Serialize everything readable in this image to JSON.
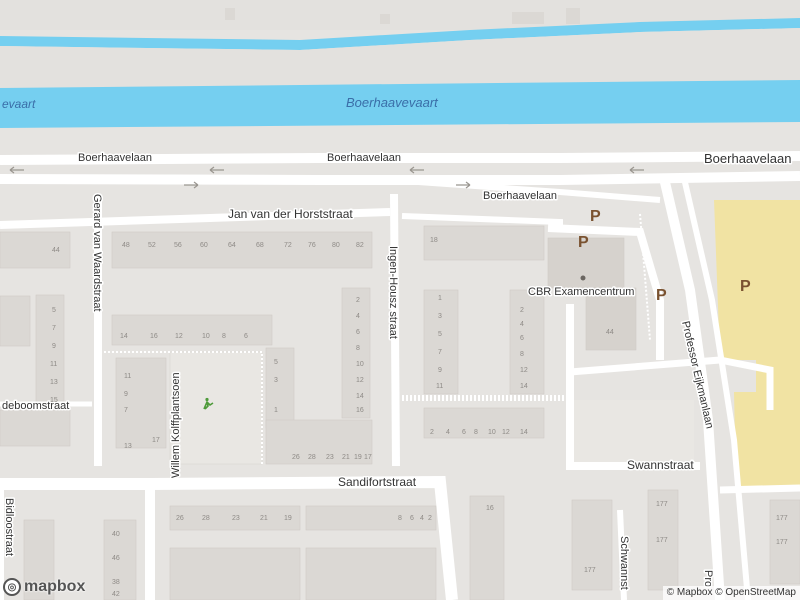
{
  "map": {
    "water": {
      "canal_name": "Boerhaavevaart",
      "canal_name_partial": "evaart"
    },
    "streets": {
      "boerhaavelaan": "Boerhaavelaan",
      "jan_van_der_horststraat": "Jan van der Horststraat",
      "gerard_van_waardstraat": "Gerard van Waardstraat",
      "ingen_housz_straat": "Ingen-Housz straat",
      "sandifortstraat": "Sandifortstraat",
      "swannstraat": "Swannstraat",
      "professor_eijkmanlaan": "Professor Eijkmanlaan",
      "willem_kolffplantsoen": "Willem Kolffplantsoen",
      "deboomstraat_partial": "deboomstraat",
      "bidloostraat_partial": "Bidloostraat",
      "schwannstraat_partial": "Schwannst",
      "prof_partial": "Pro"
    },
    "poi": {
      "cbr": "CBR Examencentrum"
    },
    "parking_symbol": "P",
    "playground_icon": "playground-icon",
    "house_numbers": {
      "row_a": [
        "48",
        "52",
        "56",
        "60",
        "64",
        "68",
        "72",
        "76",
        "80",
        "82"
      ],
      "row_b": [
        "14",
        "16",
        "12",
        "10",
        "8",
        "6"
      ],
      "row_c": [
        "2",
        "4",
        "6",
        "8",
        "10",
        "12",
        "14"
      ],
      "row_d": [
        "26",
        "28",
        "23",
        "21",
        "19",
        "17"
      ],
      "row_e": [
        "26",
        "28",
        "23",
        "21",
        "19",
        "8",
        "6",
        "4",
        "2"
      ],
      "col_a": [
        "5",
        "7",
        "9",
        "11",
        "13",
        "15",
        "17"
      ],
      "col_b": [
        "2",
        "4",
        "6",
        "8",
        "10",
        "12",
        "14",
        "16",
        "18"
      ],
      "misc": [
        "44",
        "40",
        "46",
        "38",
        "42",
        "44",
        "1",
        "3",
        "5",
        "7",
        "9",
        "11",
        "13",
        "11",
        "9",
        "7",
        "5",
        "3",
        "1",
        "16",
        "14",
        "12",
        "8",
        "6",
        "4",
        "2",
        "177",
        "177",
        "177",
        "177",
        "177"
      ]
    }
  },
  "attribution": {
    "mapbox": "© Mapbox",
    "osm": "© OpenStreetMap"
  },
  "logo": {
    "text": "mapbox"
  },
  "colors": {
    "water": "#75cff0",
    "land": "#e6e4e1",
    "road": "#ffffff",
    "building": "#dbd8d4",
    "parking_area": "#f1e3a3",
    "parking_text": "#7a5230"
  }
}
